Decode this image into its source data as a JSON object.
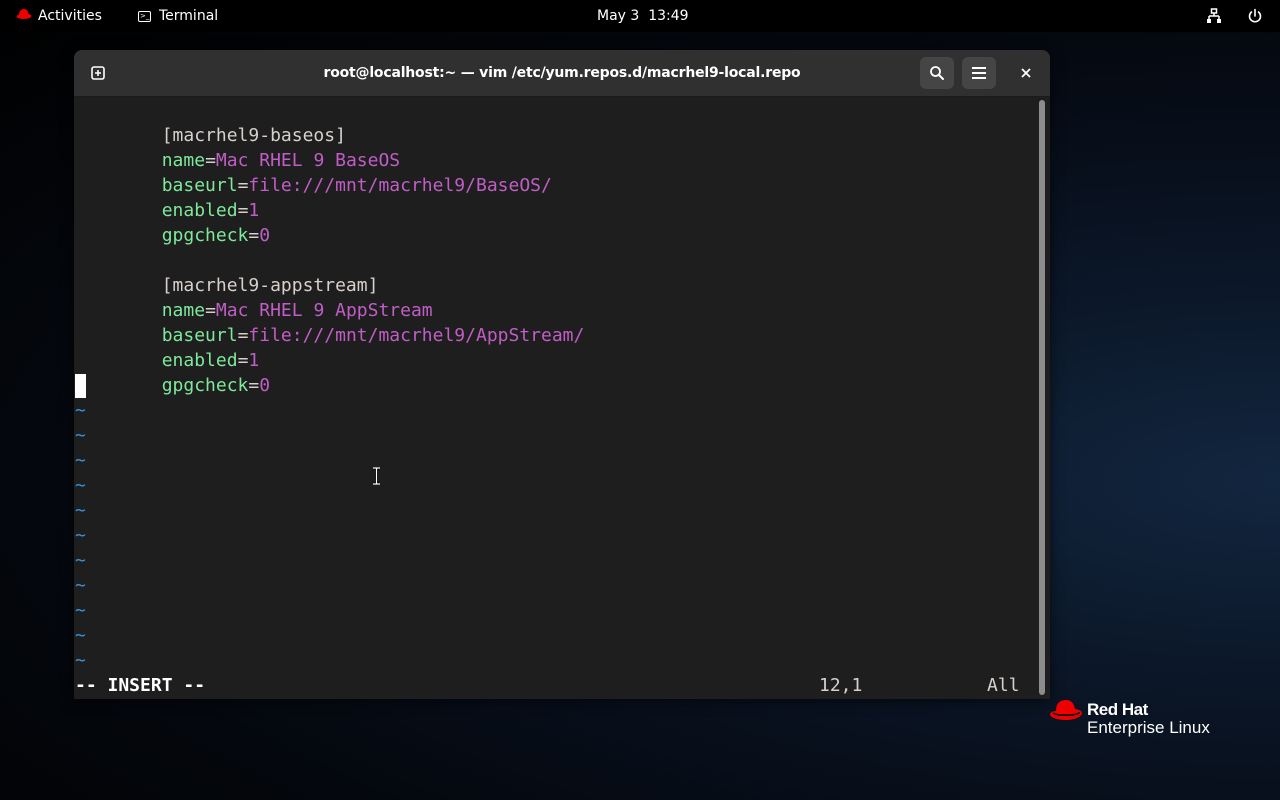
{
  "topbar": {
    "activities": "Activities",
    "app_name": "Terminal",
    "clock": "May 3  13:49"
  },
  "window": {
    "title": "root@localhost:~ — vim /etc/yum.repos.d/macrhel9-local.repo"
  },
  "editor": {
    "lines": [
      {
        "section": "[macrhel9-baseos]"
      },
      {
        "key": "name",
        "value": "Mac RHEL 9 BaseOS"
      },
      {
        "key": "baseurl",
        "value": "file:///mnt/macrhel9/BaseOS/"
      },
      {
        "key": "enabled",
        "value": "1"
      },
      {
        "key": "gpgcheck",
        "value": "0"
      },
      {
        "blank": ""
      },
      {
        "section": "[macrhel9-appstream]"
      },
      {
        "key": "name",
        "value": "Mac RHEL 9 AppStream"
      },
      {
        "key": "baseurl",
        "value": "file:///mnt/macrhel9/AppStream/"
      },
      {
        "key": "enabled",
        "value": "1"
      },
      {
        "key": "gpgcheck",
        "value": "0"
      }
    ],
    "eq": "=",
    "tilde": "~",
    "mode": "-- INSERT --",
    "position": "12,1",
    "scroll": "All"
  },
  "branding": {
    "line1": "Red Hat",
    "line2": "Enterprise Linux"
  },
  "colors": {
    "section": "#d7d0cd",
    "key": "#7ee89b",
    "value": "#c05ec6",
    "tilde": "#3d8fd9",
    "redhat": "#ee0000"
  }
}
